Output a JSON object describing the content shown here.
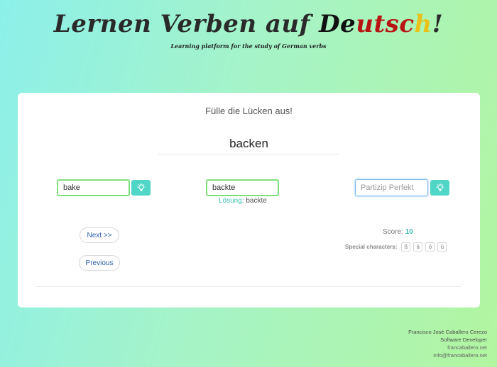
{
  "header": {
    "title_prefix": "Lernen Verben auf ",
    "title_word_parts": [
      "De",
      "utsc",
      "h"
    ],
    "title_suffix": "!",
    "subtitle": "Learning platform for the study of German verbs"
  },
  "exercise": {
    "instruction": "Fülle die Lücken aus!",
    "verb": "backen",
    "inputs": [
      {
        "value": "bake",
        "placeholder": ""
      },
      {
        "value": "backte",
        "placeholder": ""
      },
      {
        "value": "",
        "placeholder": "Partizip Perfekt"
      }
    ],
    "solution_label": "Lösung",
    "solution_sep": ":",
    "solution_value": "backte"
  },
  "nav": {
    "next_label": "Next >>",
    "previous_label": "Previous"
  },
  "score": {
    "label": "Score:",
    "value": "10"
  },
  "special_characters": {
    "label": "Special characters:",
    "chars": [
      "ß",
      "ä",
      "ö",
      "ü"
    ]
  },
  "footer": {
    "name": "Francisco José Caballero Cerezo",
    "role": "Software Developer",
    "website": "francaballero.net",
    "email": "info@francaballero.net"
  },
  "icons": {
    "hint": "lightbulb-icon"
  },
  "colors": {
    "accent": "#4fd6c6",
    "input_valid": "#7fe07b",
    "input_focus": "#7fb7ea",
    "link": "#2c5fa8",
    "flag_black": "#111111",
    "flag_red": "#b81414",
    "flag_gold": "#e8c21a"
  }
}
